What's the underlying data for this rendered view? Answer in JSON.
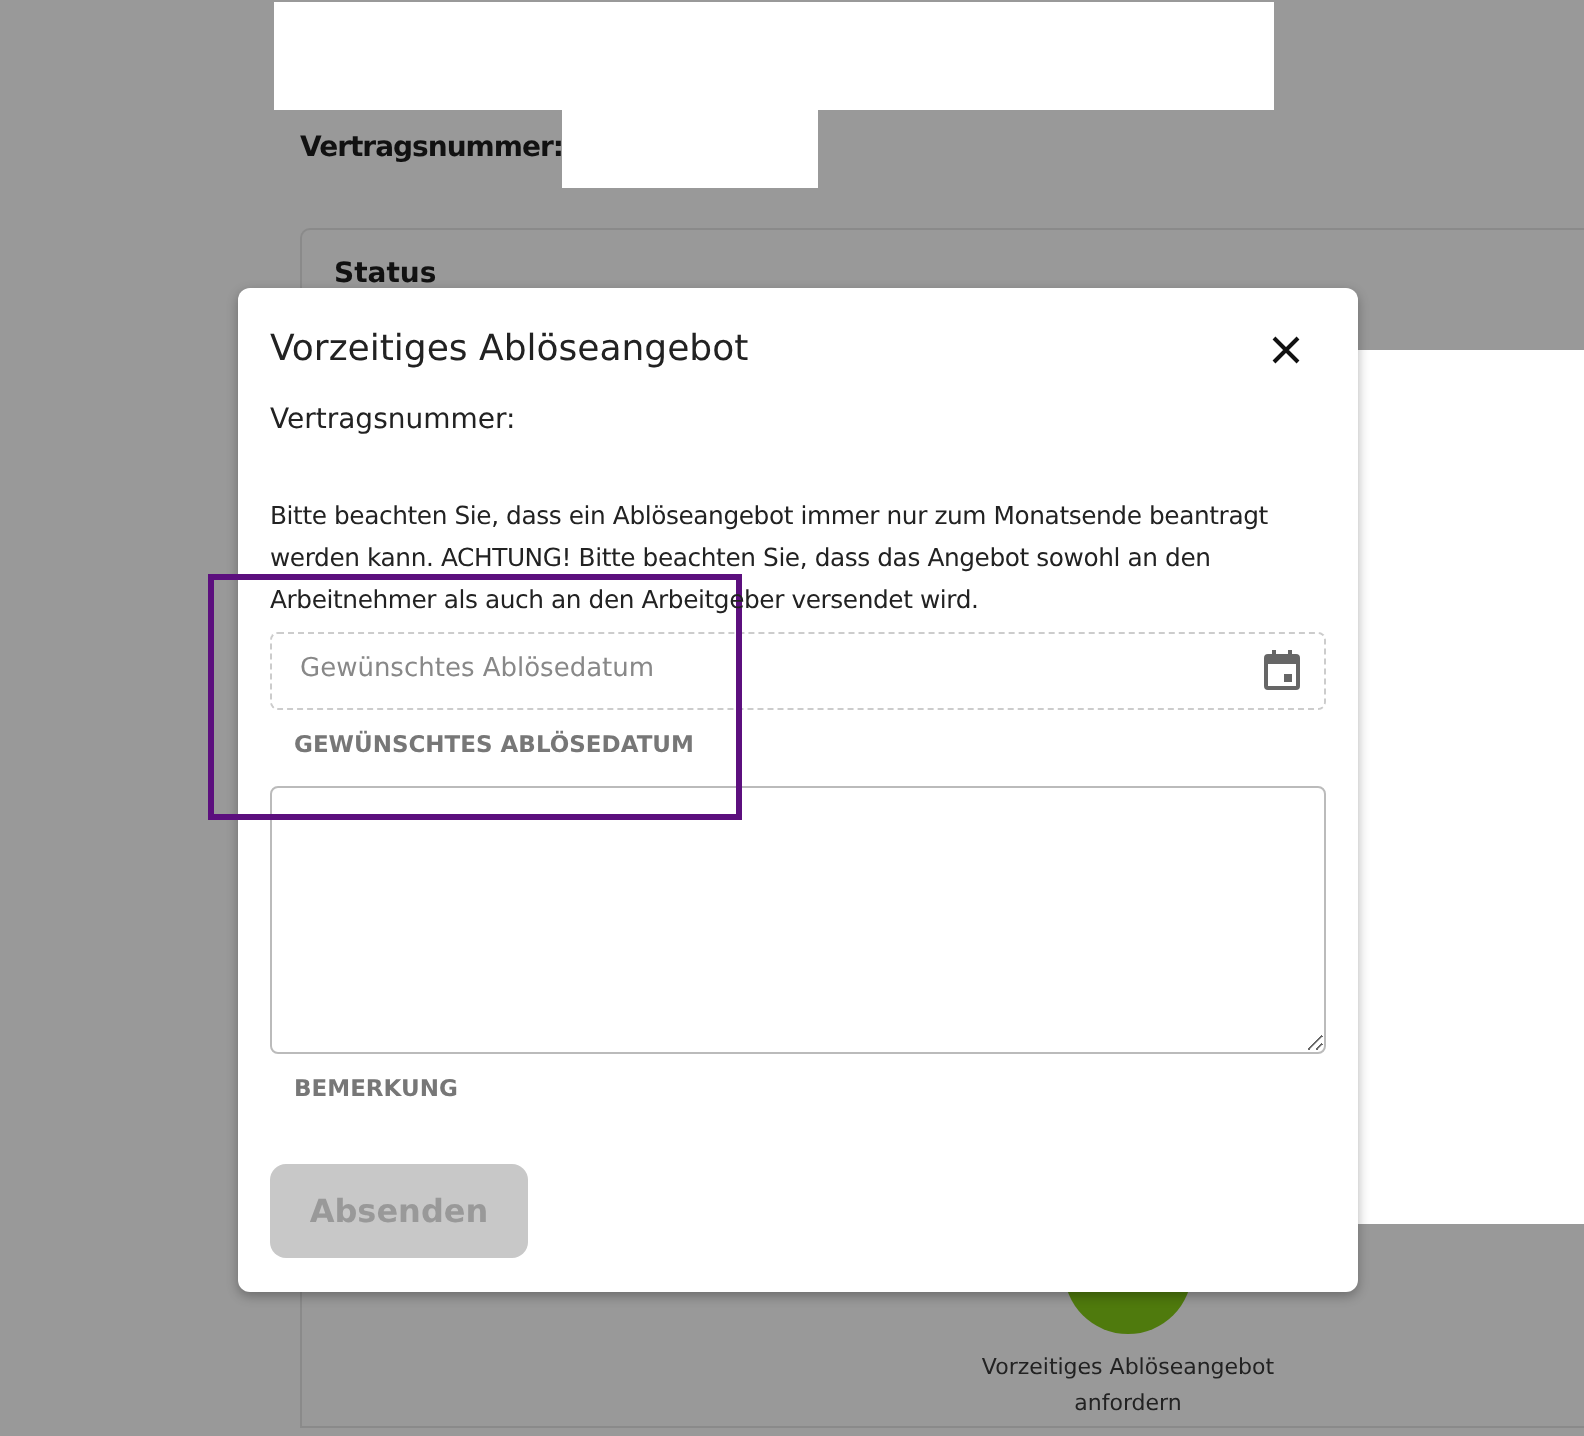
{
  "background": {
    "contract_label": "Vertragsnummer:",
    "status_title": "Status",
    "action": {
      "label": "Vorzeitiges Ablöseangebot anfordern"
    }
  },
  "dialog": {
    "title": "Vorzeitiges Ablöseangebot",
    "contract_label": "Vertragsnummer:",
    "notice": "Bitte beachten Sie, dass ein Ablöseangebot immer nur zum Monatsende beantragt werden kann. ACHTUNG! Bitte beachten Sie, dass das Angebot sowohl an den Arbeitnehmer als auch an den Arbeitgeber versendet wird.",
    "date_field": {
      "placeholder": "Gewünschtes Ablösedatum",
      "label": "GEWÜNSCHTES ABLÖSEDATUM"
    },
    "remark_field": {
      "label": "BEMERKUNG"
    },
    "submit": {
      "label": "Absenden",
      "disabled": true
    }
  }
}
